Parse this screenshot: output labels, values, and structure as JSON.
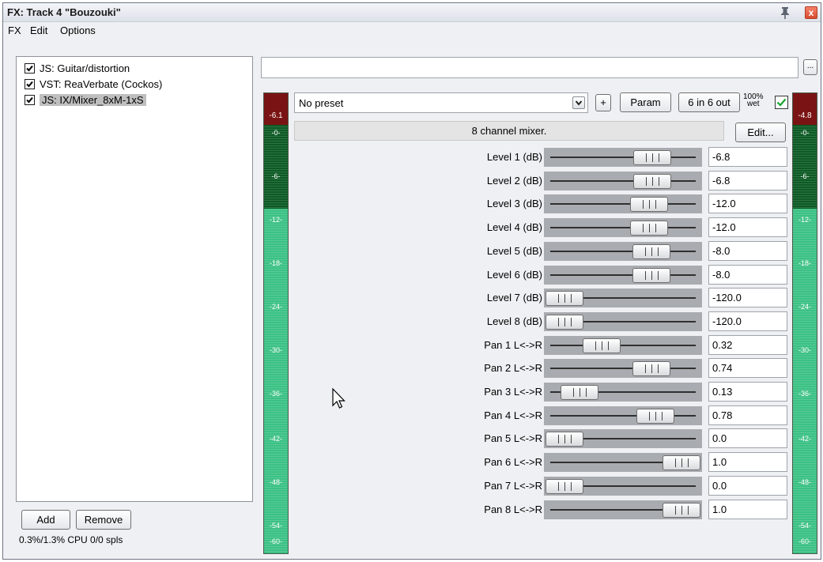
{
  "window": {
    "title": "FX: Track 4 \"Bouzouki\"",
    "close_glyph": "x"
  },
  "menu": [
    "FX",
    "Edit",
    "Options"
  ],
  "fx_list": [
    {
      "label": "JS: Guitar/distortion",
      "checked": true,
      "selected": false
    },
    {
      "label": "VST: ReaVerbate (Cockos)",
      "checked": true,
      "selected": false
    },
    {
      "label": "JS: IX/Mixer_8xM-1xS",
      "checked": true,
      "selected": true
    }
  ],
  "buttons": {
    "add": "Add",
    "remove": "Remove",
    "dots": "...",
    "plus": "+",
    "param": "Param",
    "io": "6 in 6 out",
    "edit": "Edit..."
  },
  "status": "0.3%/1.3% CPU 0/0 spls",
  "preset": "No preset",
  "wet": {
    "pct": "100%",
    "label": "wet",
    "checked": true
  },
  "description": "8 channel mixer.",
  "meters": {
    "left_value": "-6.1",
    "right_value": "-4.8",
    "ticks": [
      "-0-",
      "-6-",
      "-12-",
      "-18-",
      "-24-",
      "-30-",
      "-36-",
      "-42-",
      "-48-",
      "-54-",
      "-60-"
    ]
  },
  "params": [
    {
      "label": "Level 1 (dB)",
      "value": "-6.8",
      "pos": 0.75
    },
    {
      "label": "Level 2 (dB)",
      "value": "-6.8",
      "pos": 0.75
    },
    {
      "label": "Level 3 (dB)",
      "value": "-12.0",
      "pos": 0.72
    },
    {
      "label": "Level 4 (dB)",
      "value": "-12.0",
      "pos": 0.72
    },
    {
      "label": "Level 5 (dB)",
      "value": "-8.0",
      "pos": 0.74
    },
    {
      "label": "Level 6 (dB)",
      "value": "-8.0",
      "pos": 0.74
    },
    {
      "label": "Level 7 (dB)",
      "value": "-120.0",
      "pos": 0.0
    },
    {
      "label": "Level 8 (dB)",
      "value": "-120.0",
      "pos": 0.0
    },
    {
      "label": "Pan 1 L<->R",
      "value": "0.32",
      "pos": 0.32
    },
    {
      "label": "Pan 2 L<->R",
      "value": "0.74",
      "pos": 0.74
    },
    {
      "label": "Pan 3 L<->R",
      "value": "0.13",
      "pos": 0.13
    },
    {
      "label": "Pan 4 L<->R",
      "value": "0.78",
      "pos": 0.78
    },
    {
      "label": "Pan 5 L<->R",
      "value": "0.0",
      "pos": 0.0
    },
    {
      "label": "Pan 6 L<->R",
      "value": "1.0",
      "pos": 1.0
    },
    {
      "label": "Pan 7 L<->R",
      "value": "0.0",
      "pos": 0.0
    },
    {
      "label": "Pan 8 L<->R",
      "value": "1.0",
      "pos": 1.0
    }
  ]
}
